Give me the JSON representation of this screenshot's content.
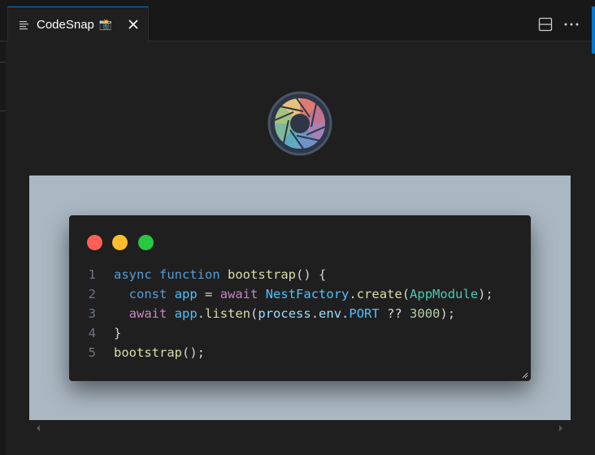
{
  "tab": {
    "title": "CodeSnap",
    "camera_glyph": "📸",
    "icon": "document-lines-icon",
    "close_icon": "close-icon"
  },
  "toolbar": {
    "split_icon": "split-editor-icon",
    "more_icon": "more-actions-icon"
  },
  "logo": {
    "icon": "aperture-logo-icon"
  },
  "snap": {
    "background_color": "#abb8c3",
    "window_color": "#1f1f1f",
    "dots": [
      "#ff5f57",
      "#febc2e",
      "#28c840"
    ],
    "code_lines": [
      {
        "num": "1",
        "tokens": [
          {
            "t": "async",
            "c": "#569cd6"
          },
          {
            "t": " ",
            "c": "#d4d4d4"
          },
          {
            "t": "function",
            "c": "#569cd6"
          },
          {
            "t": " ",
            "c": "#d4d4d4"
          },
          {
            "t": "bootstrap",
            "c": "#dcdcaa"
          },
          {
            "t": "() {",
            "c": "#d4d4d4"
          }
        ]
      },
      {
        "num": "2",
        "tokens": [
          {
            "t": "  ",
            "c": "#d4d4d4"
          },
          {
            "t": "const",
            "c": "#569cd6"
          },
          {
            "t": " ",
            "c": "#d4d4d4"
          },
          {
            "t": "app",
            "c": "#4fc1ff"
          },
          {
            "t": " = ",
            "c": "#d4d4d4"
          },
          {
            "t": "await",
            "c": "#c586c0"
          },
          {
            "t": " ",
            "c": "#d4d4d4"
          },
          {
            "t": "NestFactory",
            "c": "#4fc1ff"
          },
          {
            "t": ".",
            "c": "#d4d4d4"
          },
          {
            "t": "create",
            "c": "#dcdcaa"
          },
          {
            "t": "(",
            "c": "#d4d4d4"
          },
          {
            "t": "AppModule",
            "c": "#4ec9b0"
          },
          {
            "t": ");",
            "c": "#d4d4d4"
          }
        ]
      },
      {
        "num": "3",
        "tokens": [
          {
            "t": "  ",
            "c": "#d4d4d4"
          },
          {
            "t": "await",
            "c": "#c586c0"
          },
          {
            "t": " ",
            "c": "#d4d4d4"
          },
          {
            "t": "app",
            "c": "#4fc1ff"
          },
          {
            "t": ".",
            "c": "#d4d4d4"
          },
          {
            "t": "listen",
            "c": "#dcdcaa"
          },
          {
            "t": "(",
            "c": "#d4d4d4"
          },
          {
            "t": "process",
            "c": "#9cdcfe"
          },
          {
            "t": ".",
            "c": "#d4d4d4"
          },
          {
            "t": "env",
            "c": "#9cdcfe"
          },
          {
            "t": ".",
            "c": "#d4d4d4"
          },
          {
            "t": "PORT",
            "c": "#4fc1ff"
          },
          {
            "t": " ?? ",
            "c": "#d4d4d4"
          },
          {
            "t": "3000",
            "c": "#b5cea8"
          },
          {
            "t": ");",
            "c": "#d4d4d4"
          }
        ]
      },
      {
        "num": "4",
        "tokens": [
          {
            "t": "}",
            "c": "#d4d4d4"
          }
        ]
      },
      {
        "num": "5",
        "tokens": [
          {
            "t": "bootstrap",
            "c": "#dcdcaa"
          },
          {
            "t": "();",
            "c": "#d4d4d4"
          }
        ]
      }
    ]
  },
  "scrollbar": {
    "left_icon": "scroll-left-arrow-icon",
    "right_icon": "scroll-right-arrow-icon"
  }
}
